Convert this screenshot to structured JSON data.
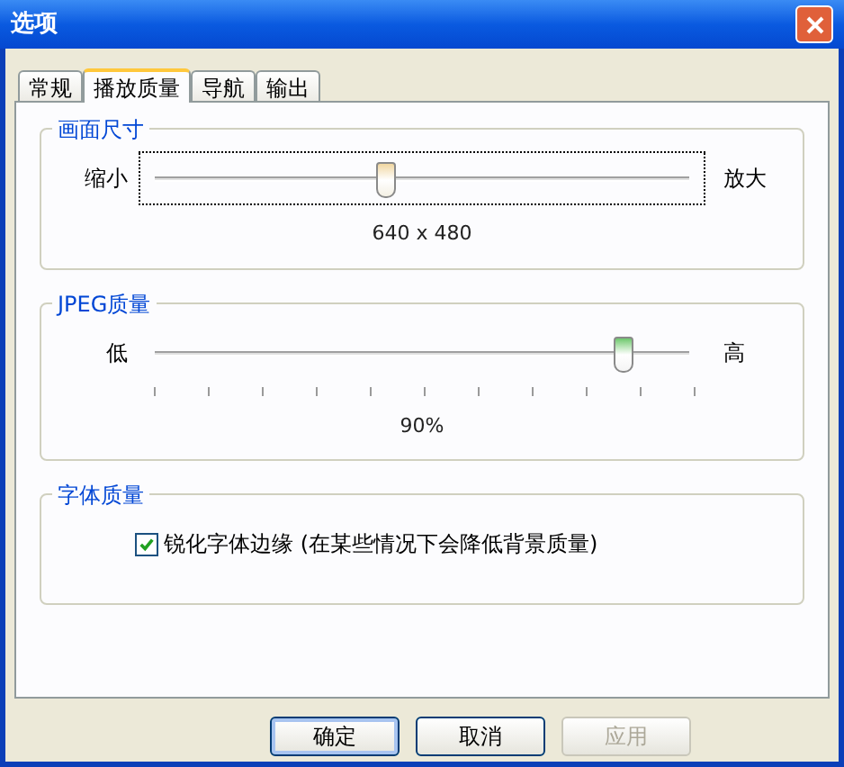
{
  "window": {
    "title": "选项"
  },
  "tabs": [
    {
      "label": "常规",
      "selected": false
    },
    {
      "label": "播放质量",
      "selected": true
    },
    {
      "label": "导航",
      "selected": false
    },
    {
      "label": "输出",
      "selected": false
    }
  ],
  "groups": [
    {
      "kind": "slider",
      "title": "画面尺寸",
      "min_label": "缩小",
      "max_label": "放大",
      "level": 0.43,
      "focused": true,
      "ticks": false,
      "reading": "640 x 480"
    },
    {
      "kind": "slider",
      "title": "JPEG质量",
      "min_label": "低",
      "max_label": "高",
      "level": 0.89,
      "focused": false,
      "ticks": true,
      "reading": "90%"
    },
    {
      "kind": "checkbox",
      "title": "字体质量",
      "checkbox": {
        "label": "锐化字体边缘 (在某些情况下会降低背景质量)",
        "checked": true
      }
    }
  ],
  "buttons": [
    {
      "label": "确定",
      "disabled": false,
      "default": true
    },
    {
      "label": "取消",
      "disabled": false,
      "default": false
    },
    {
      "label": "应用",
      "disabled": true,
      "default": false
    }
  ]
}
